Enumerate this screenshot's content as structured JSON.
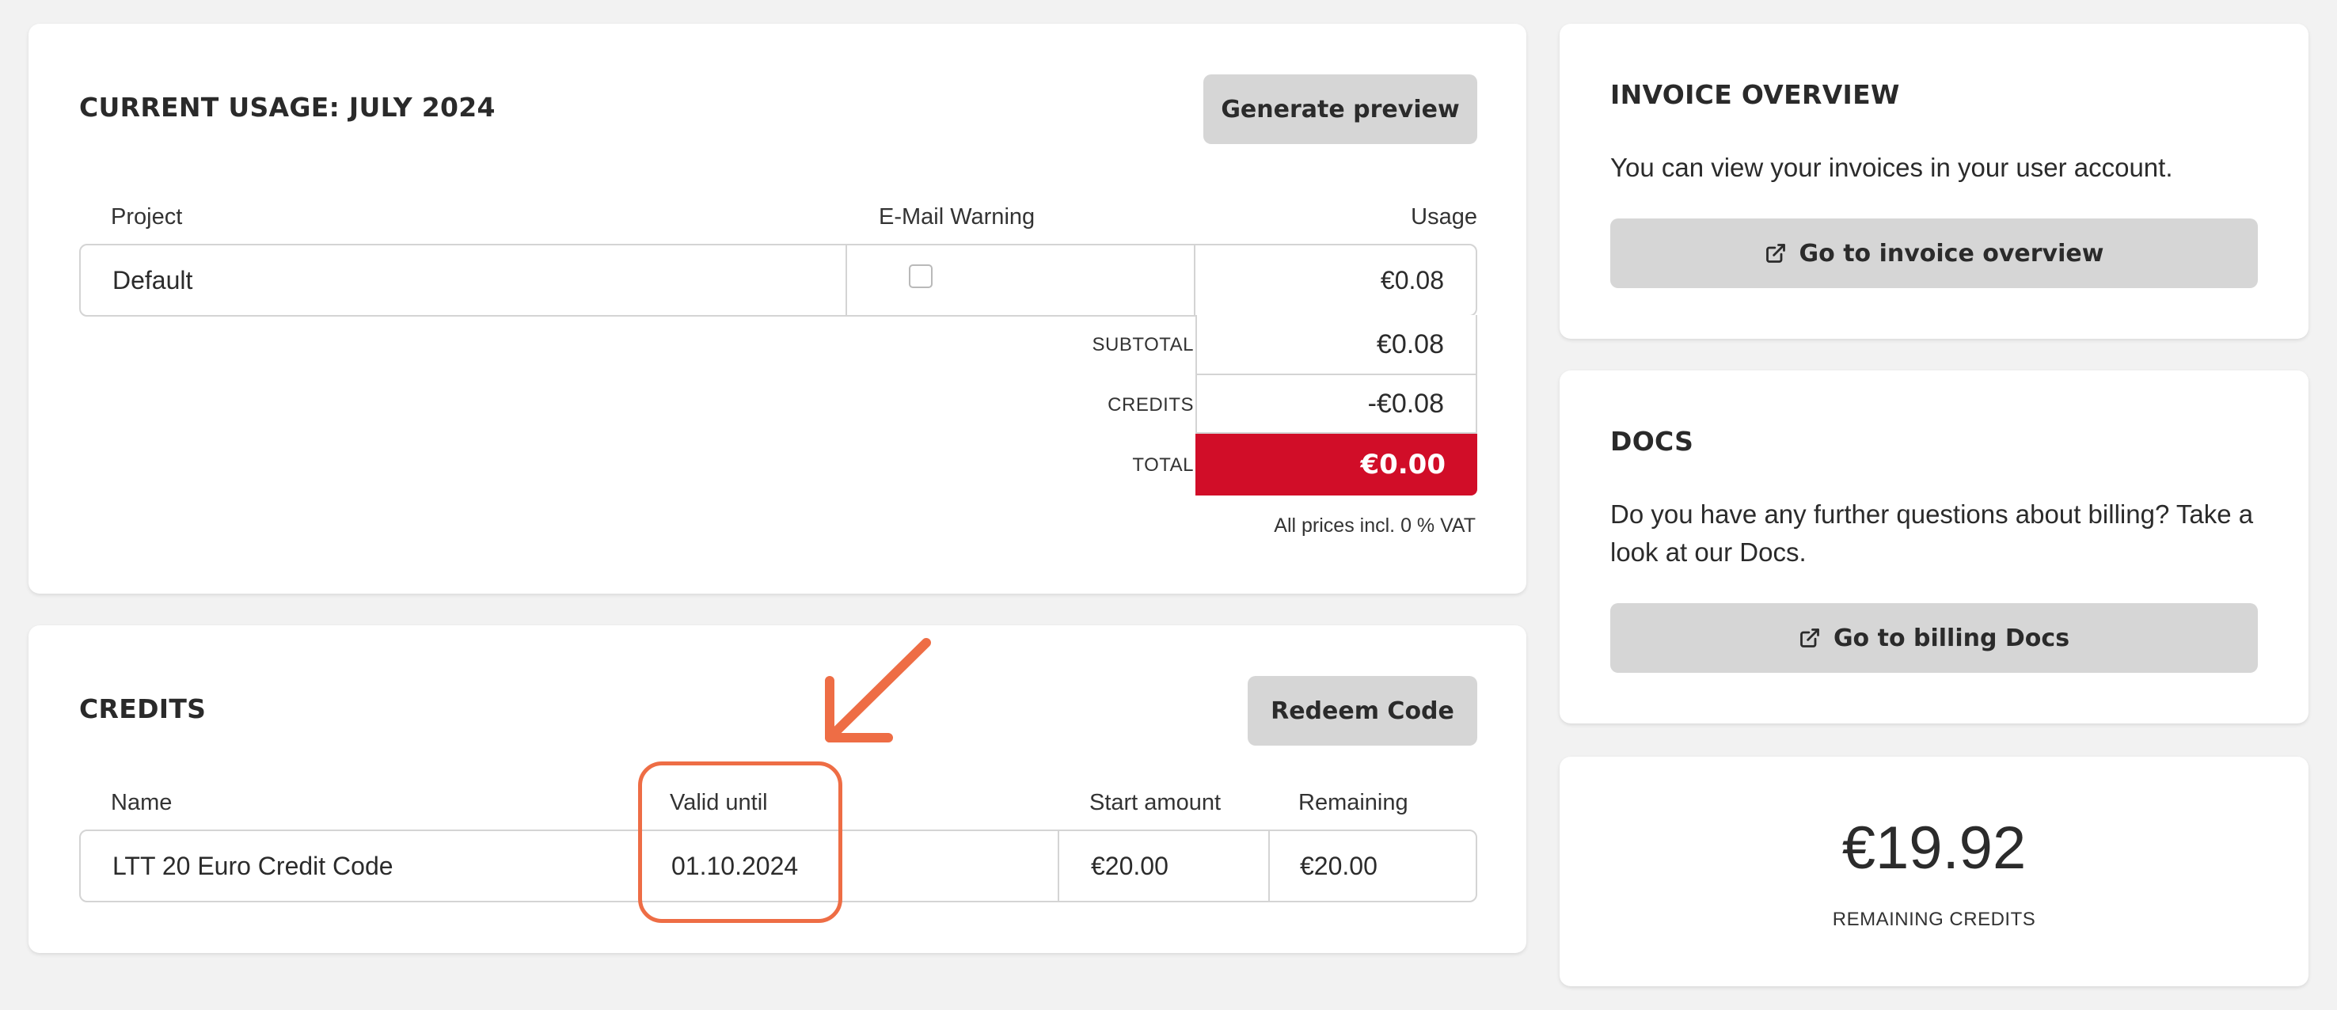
{
  "usage": {
    "title": "CURRENT USAGE: JULY 2024",
    "generate_button": "Generate preview",
    "columns": [
      "Project",
      "E-Mail Warning",
      "Usage"
    ],
    "rows": [
      {
        "project": "Default",
        "email_warning": false,
        "usage": "€0.08"
      }
    ],
    "subtotal_label": "SUBTOTAL",
    "subtotal_value": "€0.08",
    "credits_label": "CREDITS",
    "credits_value": "-€0.08",
    "total_label": "TOTAL",
    "total_value": "€0.00",
    "vat_note": "All prices incl. 0 % VAT"
  },
  "credits": {
    "title": "CREDITS",
    "redeem_button": "Redeem Code",
    "columns": [
      "Name",
      "Valid until",
      "Start amount",
      "Remaining"
    ],
    "rows": [
      {
        "name": "LTT 20 Euro Credit Code",
        "valid_until": "01.10.2024",
        "start_amount": "€20.00",
        "remaining": "€20.00"
      }
    ]
  },
  "invoice": {
    "title": "INVOICE OVERVIEW",
    "text": "You can view your invoices in your user account.",
    "button": "Go to invoice overview"
  },
  "docs": {
    "title": "DOCS",
    "text": "Do you have any further questions about billing? Take a look at our Docs.",
    "button": "Go to billing Docs"
  },
  "remaining": {
    "amount": "€19.92",
    "label": "REMAINING CREDITS"
  },
  "icons": {
    "external_link": "external-link-icon",
    "annotation": "arrow-pointer-annotation"
  },
  "colors": {
    "total_bg": "#d10d28",
    "annotation": "#ee6d45",
    "button_bg": "#d6d6d6"
  }
}
